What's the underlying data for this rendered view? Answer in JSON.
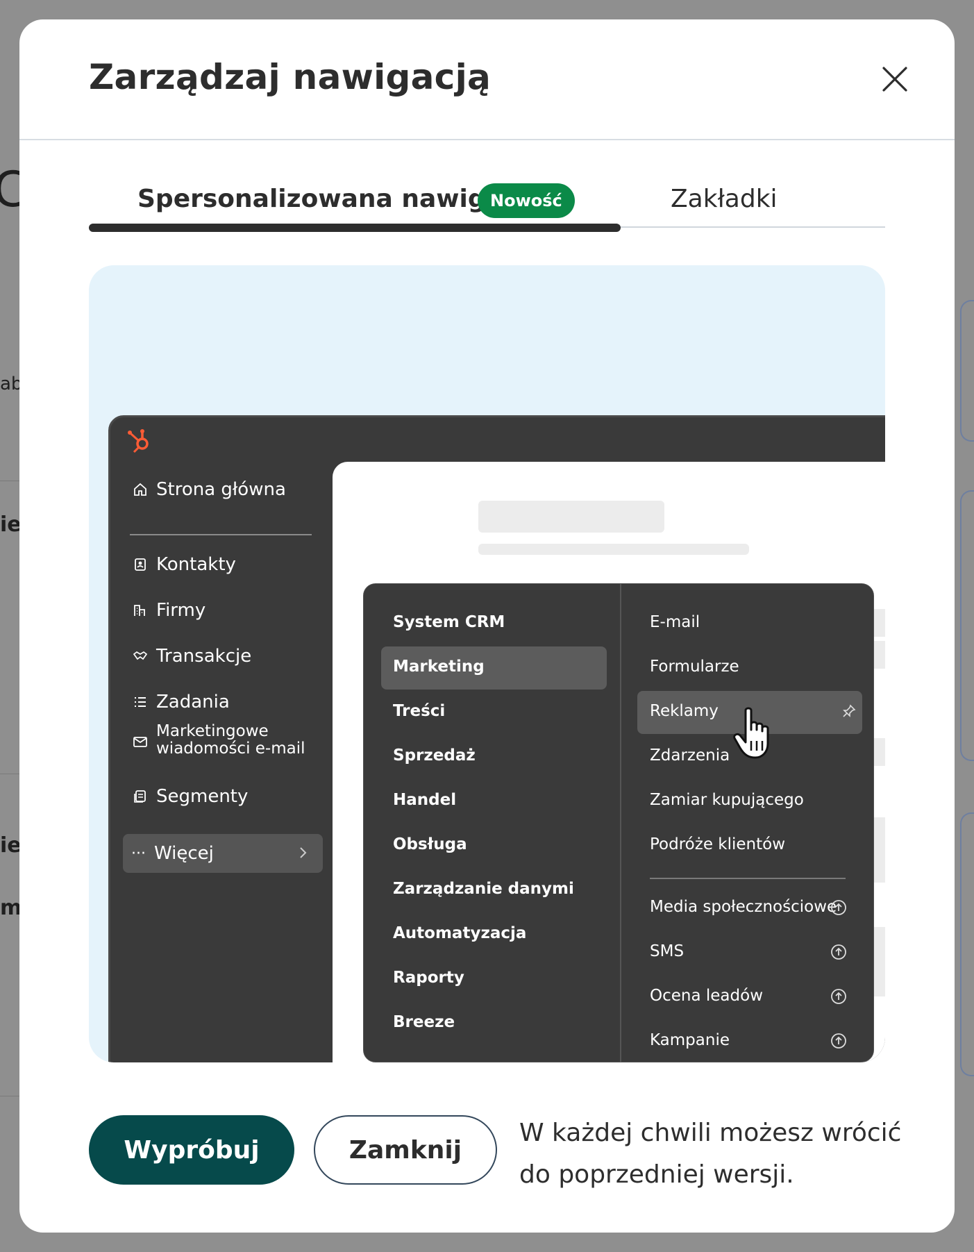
{
  "modal": {
    "title": "Zarządzaj nawigacją",
    "close_icon": "close-icon"
  },
  "tabs": [
    {
      "label": "Spersonalizowana nawigacja",
      "badge": "Nowość",
      "active": true
    },
    {
      "label": "Zakładki",
      "active": false
    }
  ],
  "preview": {
    "logo": "hubspot-sprocket-icon",
    "sidebar": {
      "home": "Strona główna",
      "items": [
        "Kontakty",
        "Firmy",
        "Transakcje",
        "Zadania",
        "Marketingowe",
        "wiadomości e-mail",
        "Segmenty"
      ],
      "more": "Więcej"
    },
    "menu_left": [
      "System CRM",
      "Marketing",
      "Treści",
      "Sprzedaż",
      "Handel",
      "Obsługa",
      "Zarządzanie danymi",
      "Automatyzacja",
      "Raporty",
      "Breeze"
    ],
    "menu_left_active": "Marketing",
    "menu_right": [
      "E-mail",
      "Formularze",
      "Reklamy",
      "Zdarzenia",
      "Zamiar kupującego",
      "Podróże klientów"
    ],
    "menu_right_active": "Reklamy",
    "menu_right_upgrade": [
      "Media społecznościowe",
      "SMS",
      "Ocena leadów",
      "Kampanie"
    ]
  },
  "footer": {
    "primary_label": "Wypróbuj",
    "secondary_label": "Zamknij",
    "note": "W każdej chwili możesz wrócić do poprzedniej wersji."
  },
  "colors": {
    "primary_button": "#064a4b",
    "badge": "#0b8a48",
    "preview_background": "#e5f3fb",
    "app_dark": "#3a3a3a",
    "logo_orange": "#ff5c35"
  }
}
